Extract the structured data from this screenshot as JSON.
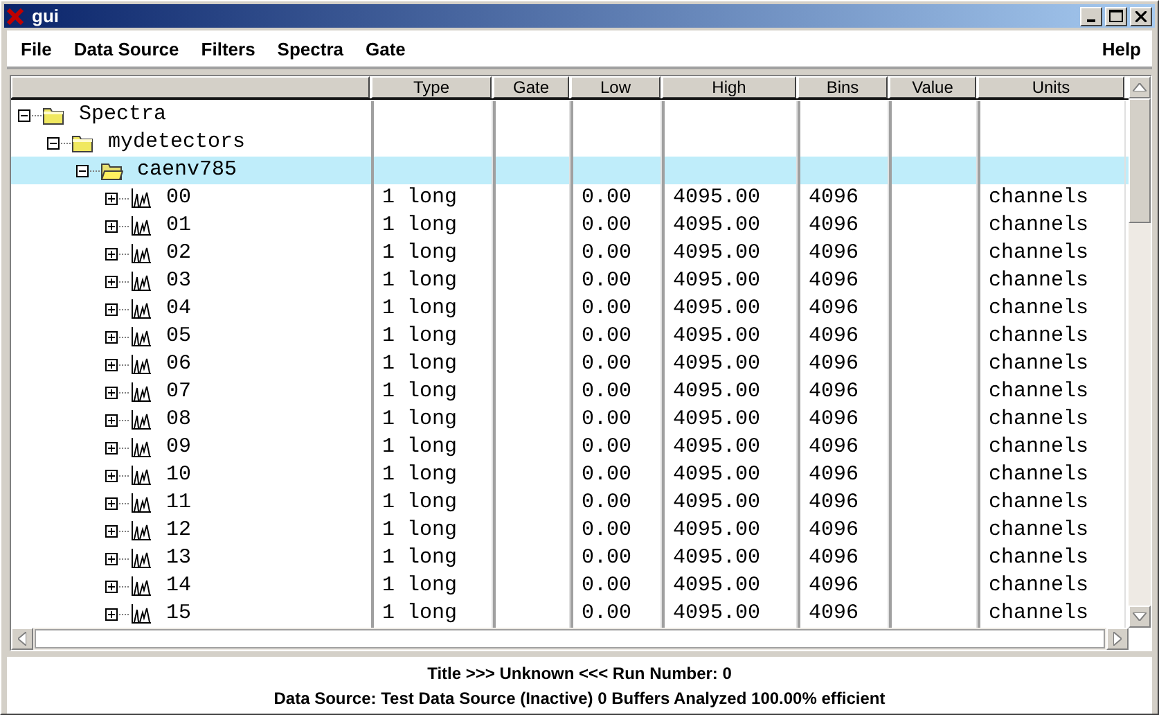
{
  "window": {
    "title": "gui"
  },
  "menu": [
    {
      "label": "File"
    },
    {
      "label": "Data Source"
    },
    {
      "label": "Filters"
    },
    {
      "label": "Spectra"
    },
    {
      "label": "Gate"
    }
  ],
  "help_menu": {
    "label": "Help"
  },
  "table": {
    "columns": [
      "Type",
      "Gate",
      "Low",
      "High",
      "Bins",
      "Value",
      "Units"
    ],
    "tree": [
      {
        "label": "Spectra",
        "kind": "folder",
        "expanded": true,
        "selected": false,
        "children": [
          {
            "label": "mydetectors",
            "kind": "folder",
            "expanded": true,
            "selected": false,
            "children": [
              {
                "label": "caenv785",
                "kind": "folder",
                "expanded": true,
                "selected": true,
                "children": [
                  {
                    "label": "00",
                    "kind": "spectrum",
                    "expanded": false,
                    "selected": false,
                    "cells": [
                      "1 long",
                      null,
                      "0.00",
                      "4095.00",
                      "4096",
                      null,
                      "channels"
                    ]
                  },
                  {
                    "label": "01",
                    "kind": "spectrum",
                    "expanded": false,
                    "selected": false,
                    "cells": [
                      "1 long",
                      null,
                      "0.00",
                      "4095.00",
                      "4096",
                      null,
                      "channels"
                    ]
                  },
                  {
                    "label": "02",
                    "kind": "spectrum",
                    "expanded": false,
                    "selected": false,
                    "cells": [
                      "1 long",
                      null,
                      "0.00",
                      "4095.00",
                      "4096",
                      null,
                      "channels"
                    ]
                  },
                  {
                    "label": "03",
                    "kind": "spectrum",
                    "expanded": false,
                    "selected": false,
                    "cells": [
                      "1 long",
                      null,
                      "0.00",
                      "4095.00",
                      "4096",
                      null,
                      "channels"
                    ]
                  },
                  {
                    "label": "04",
                    "kind": "spectrum",
                    "expanded": false,
                    "selected": false,
                    "cells": [
                      "1 long",
                      null,
                      "0.00",
                      "4095.00",
                      "4096",
                      null,
                      "channels"
                    ]
                  },
                  {
                    "label": "05",
                    "kind": "spectrum",
                    "expanded": false,
                    "selected": false,
                    "cells": [
                      "1 long",
                      null,
                      "0.00",
                      "4095.00",
                      "4096",
                      null,
                      "channels"
                    ]
                  },
                  {
                    "label": "06",
                    "kind": "spectrum",
                    "expanded": false,
                    "selected": false,
                    "cells": [
                      "1 long",
                      null,
                      "0.00",
                      "4095.00",
                      "4096",
                      null,
                      "channels"
                    ]
                  },
                  {
                    "label": "07",
                    "kind": "spectrum",
                    "expanded": false,
                    "selected": false,
                    "cells": [
                      "1 long",
                      null,
                      "0.00",
                      "4095.00",
                      "4096",
                      null,
                      "channels"
                    ]
                  },
                  {
                    "label": "08",
                    "kind": "spectrum",
                    "expanded": false,
                    "selected": false,
                    "cells": [
                      "1 long",
                      null,
                      "0.00",
                      "4095.00",
                      "4096",
                      null,
                      "channels"
                    ]
                  },
                  {
                    "label": "09",
                    "kind": "spectrum",
                    "expanded": false,
                    "selected": false,
                    "cells": [
                      "1 long",
                      null,
                      "0.00",
                      "4095.00",
                      "4096",
                      null,
                      "channels"
                    ]
                  },
                  {
                    "label": "10",
                    "kind": "spectrum",
                    "expanded": false,
                    "selected": false,
                    "cells": [
                      "1 long",
                      null,
                      "0.00",
                      "4095.00",
                      "4096",
                      null,
                      "channels"
                    ]
                  },
                  {
                    "label": "11",
                    "kind": "spectrum",
                    "expanded": false,
                    "selected": false,
                    "cells": [
                      "1 long",
                      null,
                      "0.00",
                      "4095.00",
                      "4096",
                      null,
                      "channels"
                    ]
                  },
                  {
                    "label": "12",
                    "kind": "spectrum",
                    "expanded": false,
                    "selected": false,
                    "cells": [
                      "1 long",
                      null,
                      "0.00",
                      "4095.00",
                      "4096",
                      null,
                      "channels"
                    ]
                  },
                  {
                    "label": "13",
                    "kind": "spectrum",
                    "expanded": false,
                    "selected": false,
                    "cells": [
                      "1 long",
                      null,
                      "0.00",
                      "4095.00",
                      "4096",
                      null,
                      "channels"
                    ]
                  },
                  {
                    "label": "14",
                    "kind": "spectrum",
                    "expanded": false,
                    "selected": false,
                    "cells": [
                      "1 long",
                      null,
                      "0.00",
                      "4095.00",
                      "4096",
                      null,
                      "channels"
                    ]
                  },
                  {
                    "label": "15",
                    "kind": "spectrum",
                    "expanded": false,
                    "selected": false,
                    "cells": [
                      "1 long",
                      null,
                      "0.00",
                      "4095.00",
                      "4096",
                      null,
                      "channels"
                    ]
                  }
                ]
              }
            ]
          }
        ]
      }
    ]
  },
  "status_bar": [
    "Title >>> Unknown <<< Run Number: 0",
    "Data Source: Test Data Source (Inactive) 0 Buffers Analyzed 100.00% efficient"
  ]
}
